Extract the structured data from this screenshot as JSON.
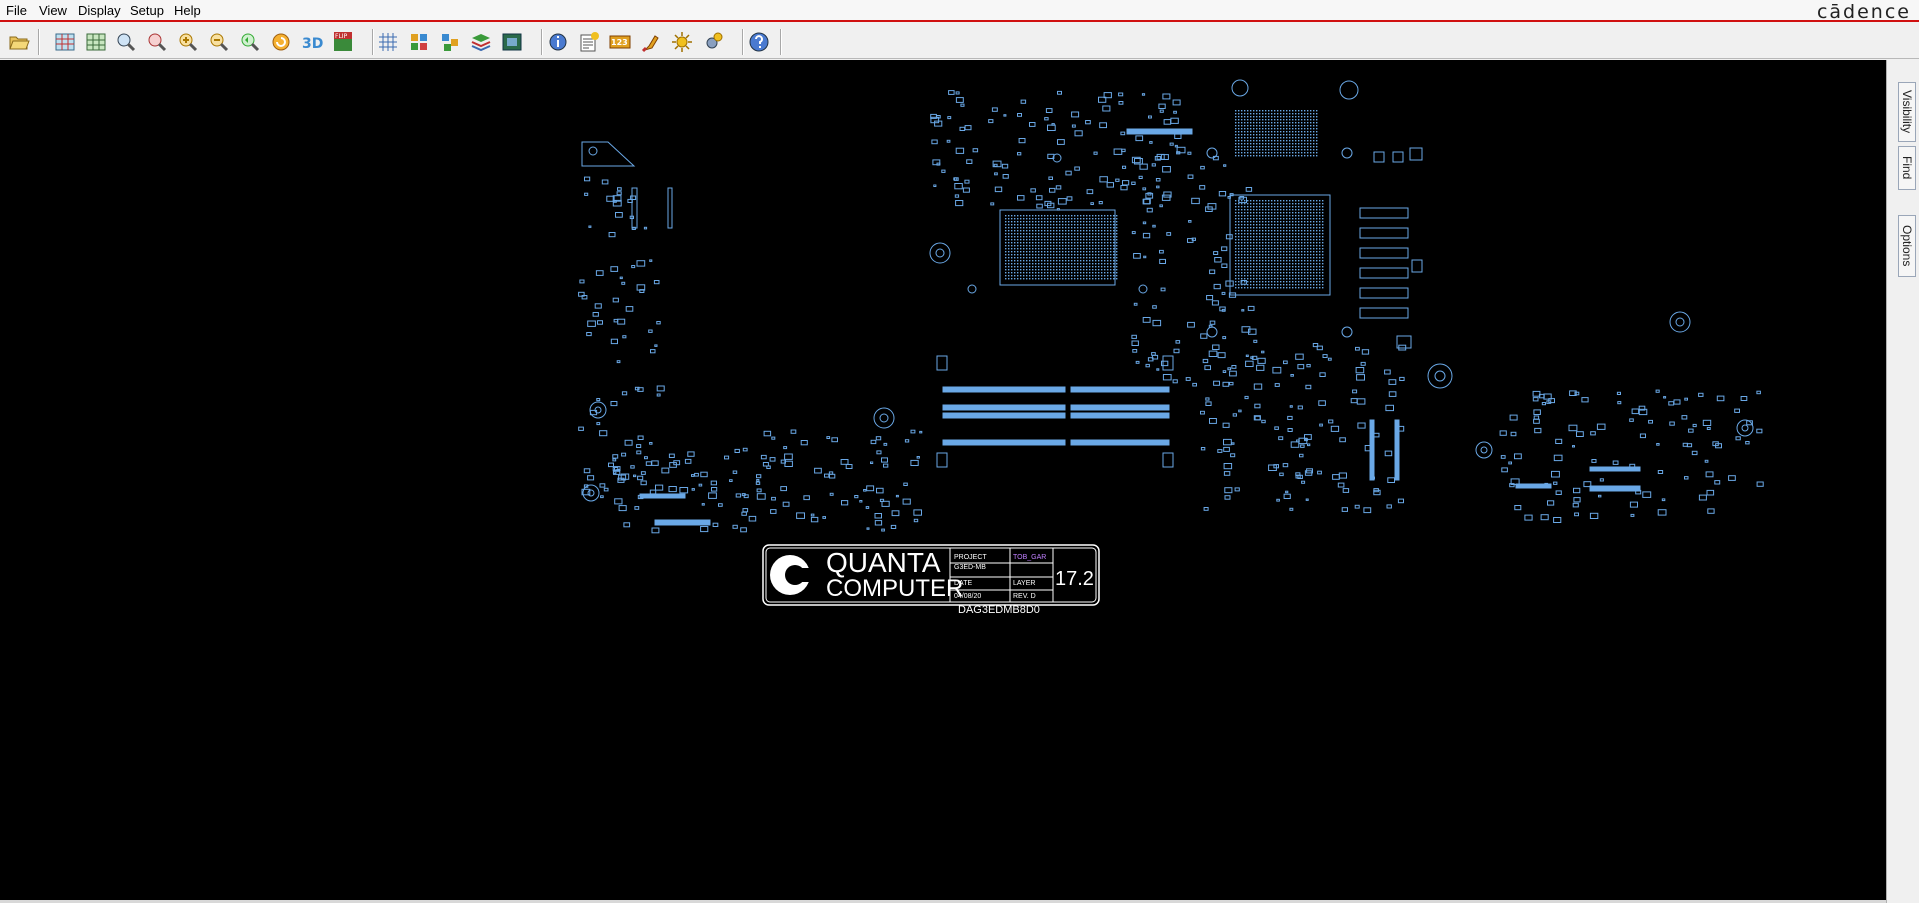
{
  "menubar": {
    "items": [
      {
        "label": "File"
      },
      {
        "label": "View"
      },
      {
        "label": "Display"
      },
      {
        "label": "Setup"
      },
      {
        "label": "Help"
      }
    ],
    "brand": "cādence"
  },
  "toolbar": {
    "buttons": [
      {
        "icon": "open-folder-icon"
      },
      {
        "icon": "zoom-fit-icon"
      },
      {
        "icon": "zoom-grid-icon"
      },
      {
        "icon": "zoom-world-icon"
      },
      {
        "icon": "zoom-window-icon"
      },
      {
        "icon": "zoom-in-icon"
      },
      {
        "icon": "zoom-out-icon"
      },
      {
        "icon": "zoom-previous-icon"
      },
      {
        "icon": "refresh-icon"
      },
      {
        "icon": "3d-view-icon"
      },
      {
        "icon": "flip-icon",
        "label": "FLIP"
      },
      {
        "icon": "grid-icon"
      },
      {
        "icon": "layers-icon"
      },
      {
        "icon": "color-layers-icon"
      },
      {
        "icon": "stackup-icon"
      },
      {
        "icon": "board-icon"
      },
      {
        "icon": "info-icon"
      },
      {
        "icon": "report-icon"
      },
      {
        "icon": "measure-icon",
        "label": "123"
      },
      {
        "icon": "highlight-icon"
      },
      {
        "icon": "brightness-icon"
      },
      {
        "icon": "settings-sun-icon"
      },
      {
        "icon": "help-icon"
      }
    ]
  },
  "side_panel": {
    "tabs": [
      {
        "label": "Visibility"
      },
      {
        "label": "Find"
      },
      {
        "label": "Options"
      }
    ]
  },
  "title_block": {
    "company_line1": "QUANTA",
    "company_line2": "COMPUTER",
    "project_label": "PROJECT",
    "project_value": "G3ED-MB",
    "date_label": "DATE",
    "date_value": "04/08/20",
    "layer_label": "LAYER",
    "layer_value_top": "TOB_GAR",
    "rev_label": "REV. D",
    "part_number": "DAG3EDMB8D0",
    "version": "17.2"
  },
  "colors": {
    "canvas_background": "#000000",
    "component_outline": "#6aa8e6",
    "menubar_accent": "#d01010",
    "title_block": "#ffffff"
  }
}
